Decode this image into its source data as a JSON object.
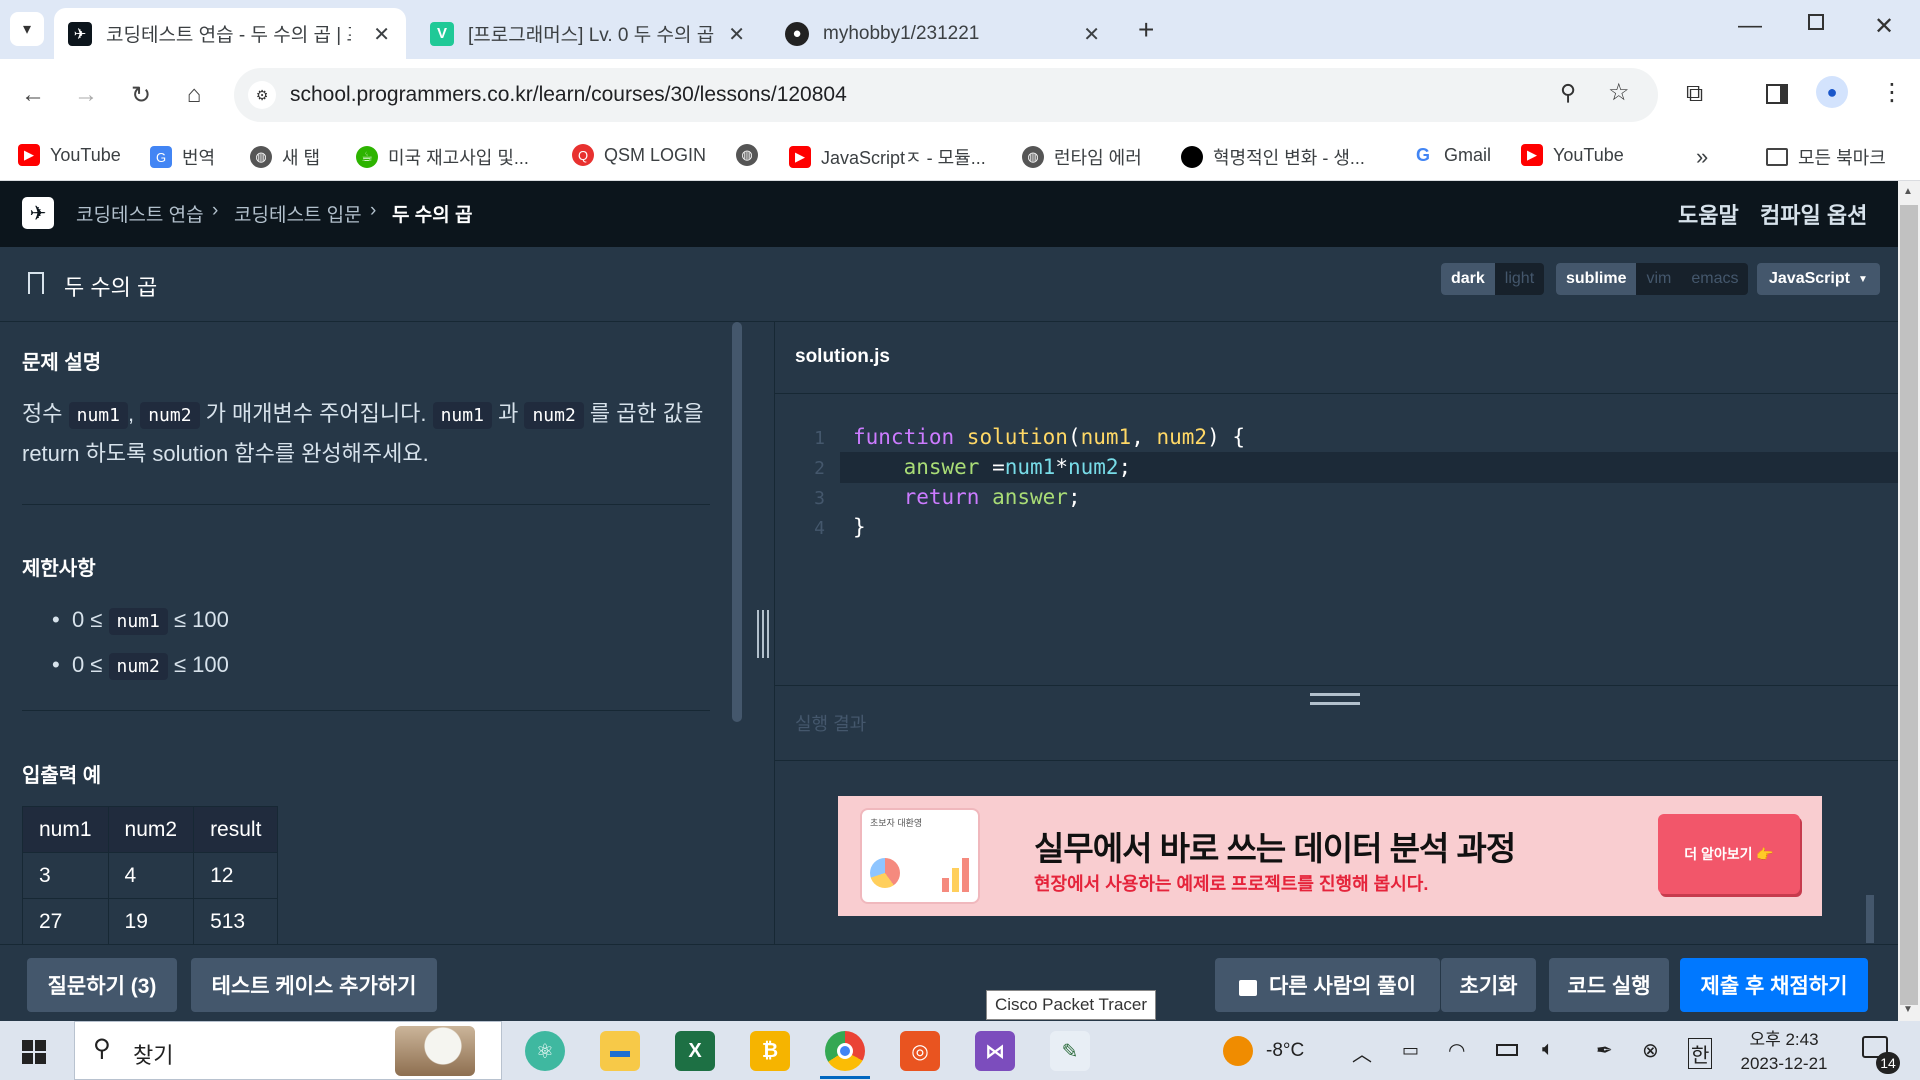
{
  "browser": {
    "tabs": [
      {
        "title": "코딩테스트 연습 - 두 수의 곱 | 프로그래머스 스쿨",
        "favicon": "programmers-icon",
        "active": true
      },
      {
        "title": "[프로그래머스] Lv. 0 두 수의 곱",
        "favicon": "velog-icon",
        "active": false
      },
      {
        "title": "myhobby1/231221",
        "favicon": "github-icon",
        "active": false
      }
    ],
    "url": "school.programmers.co.kr/learn/courses/30/lessons/120804",
    "bookmarks": [
      {
        "label": "YouTube",
        "icon": "youtube-icon"
      },
      {
        "label": "번역",
        "icon": "translate-icon"
      },
      {
        "label": "새 탭",
        "icon": "globe-icon"
      },
      {
        "label": "미국 재고사입 및...",
        "icon": "cup-icon"
      },
      {
        "label": "QSM LOGIN",
        "icon": "qsm-icon"
      },
      {
        "label": "",
        "icon": "globe-icon"
      },
      {
        "label": "JavaScriptㅈ - 모듈...",
        "icon": "youtube-icon"
      },
      {
        "label": "런타임 에러",
        "icon": "globe-icon"
      },
      {
        "label": "혁명적인 변화 - 생...",
        "icon": "dot-icon"
      },
      {
        "label": "Gmail",
        "icon": "google-icon"
      },
      {
        "label": "YouTube",
        "icon": "youtube-icon"
      }
    ],
    "all_bookmarks": "모든 북마크",
    "more": "»"
  },
  "app": {
    "breadcrumb": [
      "코딩테스트 연습",
      "코딩테스트 입문",
      "두 수의 곱"
    ],
    "help": "도움말",
    "compile_options": "컴파일 옵션",
    "problem_title": "두 수의 곱",
    "themes": [
      "dark",
      "light"
    ],
    "keymaps": [
      "sublime",
      "vim",
      "emacs"
    ],
    "language": "JavaScript",
    "description_heading": "문제 설명",
    "description": {
      "p1": "정수",
      "var1": "num1",
      "comma": ",",
      "var2": "num2",
      "p2": "가 매개변수 주어집니다.",
      "var3": "num1",
      "p3": "과",
      "var4": "num2",
      "p4": "를 곱한 값을",
      "line2": "return 하도록 solution 함수를 완성해주세요."
    },
    "constraints_heading": "제한사항",
    "constraints": [
      {
        "pre": "0 ≤",
        "var": "num1",
        "post": "≤ 100"
      },
      {
        "pre": "0 ≤",
        "var": "num2",
        "post": "≤ 100"
      }
    ],
    "io_heading": "입출력 예",
    "io_table": {
      "headers": [
        "num1",
        "num2",
        "result"
      ],
      "rows": [
        [
          "3",
          "4",
          "12"
        ],
        [
          "27",
          "19",
          "513"
        ]
      ]
    },
    "filename": "solution.js",
    "code_lines": [
      {
        "no": "1",
        "tokens": [
          [
            "function ",
            "kw"
          ],
          [
            "solution",
            "fn"
          ],
          [
            "(",
            ""
          ],
          [
            "num1",
            "fn"
          ],
          [
            ", ",
            ""
          ],
          [
            "num2",
            "fn"
          ],
          [
            ") {",
            ""
          ]
        ]
      },
      {
        "no": "2",
        "tokens": [
          [
            "    answer ",
            "gr"
          ],
          [
            "=",
            ""
          ],
          [
            "num1",
            "vr"
          ],
          [
            "*",
            ""
          ],
          [
            "num2",
            "vr"
          ],
          [
            ";",
            ""
          ]
        ]
      },
      {
        "no": "3",
        "tokens": [
          [
            "    return ",
            "kw"
          ],
          [
            "answer",
            "gr"
          ],
          [
            ";",
            ""
          ]
        ]
      },
      {
        "no": "4",
        "tokens": [
          [
            "}",
            ""
          ]
        ]
      }
    ],
    "result_label": "실행 결과",
    "ad": {
      "tag": "초보자 대환영",
      "title": "실무에서 바로 쓰는 데이터 분석 과정",
      "subtitle": "현장에서 사용하는 예제로 프로젝트를 진행해 봅시다.",
      "cta": "더 알아보기 👉"
    },
    "buttons": {
      "ask": "질문하기 (3)",
      "add_test": "테스트 케이스 추가하기",
      "others": "다른 사람의 풀이",
      "reset": "초기화",
      "run": "코드 실행",
      "submit": "제출 후 채점하기"
    }
  },
  "taskbar": {
    "search_placeholder": "찾기",
    "tooltip": "Cisco Packet Tracer",
    "weather": "-8°C",
    "ime": "한",
    "time": "오후 2:43",
    "date": "2023-12-21",
    "notifications": "14"
  },
  "colors": {
    "accent": "#0078ff",
    "bg": "#263747",
    "nav": "#0c151c"
  }
}
